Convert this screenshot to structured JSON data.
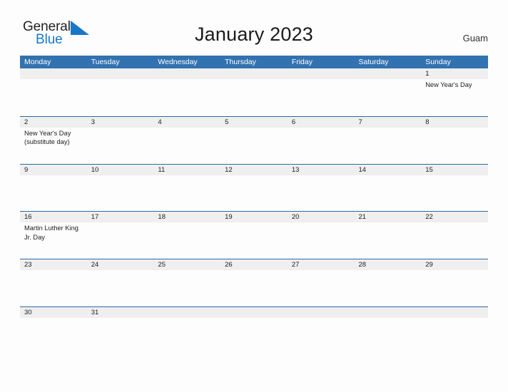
{
  "brand": {
    "name_part1": "General",
    "name_part2": "Blue",
    "flag_icon": "blue-flag-triangle",
    "color_dark": "#231f20",
    "color_blue": "#1878c8"
  },
  "header": {
    "title": "January 2023",
    "location": "Guam"
  },
  "theme": {
    "header_blue": "#3272b0",
    "rule_blue": "#2a6aa8",
    "number_band_gray": "#efefef",
    "page_background": "#fdfdfd",
    "text": "#1c1c1c"
  },
  "calendar": {
    "weekday_headers": [
      "Monday",
      "Tuesday",
      "Wednesday",
      "Thursday",
      "Friday",
      "Saturday",
      "Sunday"
    ],
    "weeks": [
      {
        "days": [
          {
            "number": "",
            "event": ""
          },
          {
            "number": "",
            "event": ""
          },
          {
            "number": "",
            "event": ""
          },
          {
            "number": "",
            "event": ""
          },
          {
            "number": "",
            "event": ""
          },
          {
            "number": "",
            "event": ""
          },
          {
            "number": "1",
            "event": "New Year's Day"
          }
        ]
      },
      {
        "days": [
          {
            "number": "2",
            "event": "New Year's Day\n(substitute day)"
          },
          {
            "number": "3",
            "event": ""
          },
          {
            "number": "4",
            "event": ""
          },
          {
            "number": "5",
            "event": ""
          },
          {
            "number": "6",
            "event": ""
          },
          {
            "number": "7",
            "event": ""
          },
          {
            "number": "8",
            "event": ""
          }
        ]
      },
      {
        "days": [
          {
            "number": "9",
            "event": ""
          },
          {
            "number": "10",
            "event": ""
          },
          {
            "number": "11",
            "event": ""
          },
          {
            "number": "12",
            "event": ""
          },
          {
            "number": "13",
            "event": ""
          },
          {
            "number": "14",
            "event": ""
          },
          {
            "number": "15",
            "event": ""
          }
        ]
      },
      {
        "days": [
          {
            "number": "16",
            "event": "Martin Luther King\nJr. Day"
          },
          {
            "number": "17",
            "event": ""
          },
          {
            "number": "18",
            "event": ""
          },
          {
            "number": "19",
            "event": ""
          },
          {
            "number": "20",
            "event": ""
          },
          {
            "number": "21",
            "event": ""
          },
          {
            "number": "22",
            "event": ""
          }
        ]
      },
      {
        "days": [
          {
            "number": "23",
            "event": ""
          },
          {
            "number": "24",
            "event": ""
          },
          {
            "number": "25",
            "event": ""
          },
          {
            "number": "26",
            "event": ""
          },
          {
            "number": "27",
            "event": ""
          },
          {
            "number": "28",
            "event": ""
          },
          {
            "number": "29",
            "event": ""
          }
        ]
      },
      {
        "days": [
          {
            "number": "30",
            "event": ""
          },
          {
            "number": "31",
            "event": ""
          },
          {
            "number": "",
            "event": ""
          },
          {
            "number": "",
            "event": ""
          },
          {
            "number": "",
            "event": ""
          },
          {
            "number": "",
            "event": ""
          },
          {
            "number": "",
            "event": ""
          }
        ]
      }
    ]
  }
}
